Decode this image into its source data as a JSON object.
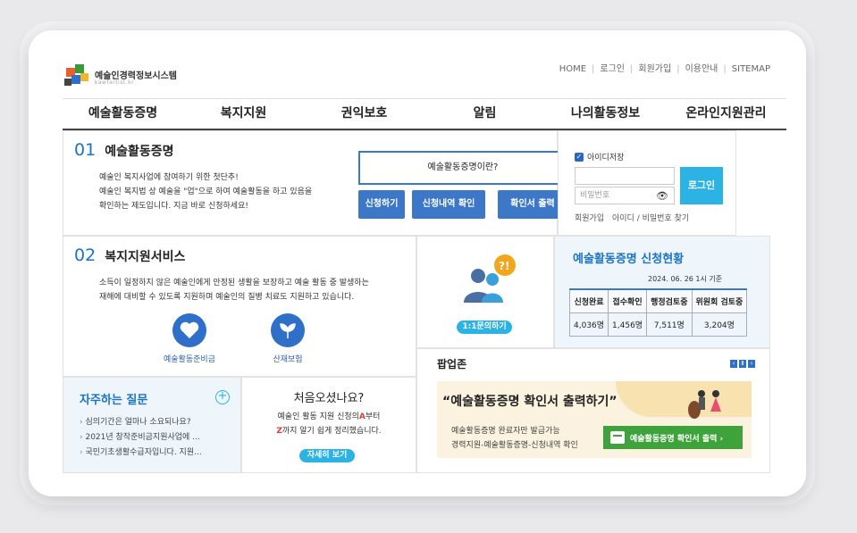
{
  "site": {
    "title": "예술인경력정보시스템",
    "subtitle": "kawfartist.kr"
  },
  "util_links": [
    "HOME",
    "로그인",
    "회원가입",
    "이용안내",
    "SITEMAP"
  ],
  "gnb": [
    "예술활동증명",
    "복지지원",
    "권익보호",
    "알림",
    "나의활동정보",
    "온라인지원관리"
  ],
  "section1": {
    "num": "01",
    "title": "예술활동증명",
    "desc": [
      "예술인 복지사업에 참여하기 위한 첫단추!",
      "예술인 복지법 상 예술을 \"업\"으로 하여 예술활동을 하고 있음을",
      "확인하는 제도입니다. 지금 바로 신청하세요!"
    ],
    "what_label": "예술활동증명이란?",
    "buttons": [
      "신청하기",
      "신청내역 확인",
      "확인서 출력"
    ]
  },
  "login": {
    "save_id": "아이디저장",
    "id_placeholder": "",
    "pw_placeholder": "비밀번호",
    "login_label": "로그인",
    "join": "회원가입",
    "find": "아이디 / 비밀번호 찾기"
  },
  "section2": {
    "num": "02",
    "title": "복지지원서비스",
    "desc": [
      "소득이 일정하지 않은 예술인에게 안정된 생활을 보장하고 예술 활동 중 발생하는",
      "재해에 대비할 수 있도록 지원하며 예술인의 질병 치료도 지원하고 있습니다."
    ],
    "services": [
      "예술활동준비금",
      "산재보험"
    ]
  },
  "inquiry": {
    "label": "1:1문의하기"
  },
  "stats": {
    "title": "예술활동증명 신청현황",
    "date": "2024. 06. 26  1시 기준",
    "headers": [
      "신청완료",
      "접수확인",
      "행정검토중",
      "위원회 검토중"
    ],
    "values": [
      "4,036명",
      "1,456명",
      "7,511명",
      "3,204명"
    ]
  },
  "faq": {
    "title": "자주하는 질문",
    "items": [
      "심의기간은 얼마나 소요되나요?",
      "2021년 창작준비금지원사업에 ...",
      "국민기초생활수급자입니다. 지원..."
    ]
  },
  "first_visit": {
    "title": "처음오셨나요?",
    "line1_a": "예술인 활동 지원 신청의",
    "line1_b": "A",
    "line1_c": "부터",
    "line2_a": "Z",
    "line2_b": "까지 알기 쉽게 정리했습니다.",
    "button": "자세히 보기"
  },
  "popup": {
    "title": "팝업존",
    "headline": "“예술활동증명 확인서 출력하기”",
    "line1": "예술활동증명 완료자만 발급가능",
    "line2": "경력지원-예술활동증명-신청내역 확인",
    "button": "예술활동증명 확인서 출력 ›",
    "accent": "#3fa33b"
  },
  "colors": {
    "primary": "#3d77c8",
    "cyan": "#2bb3e6",
    "dark_nav_line": "#444444"
  }
}
